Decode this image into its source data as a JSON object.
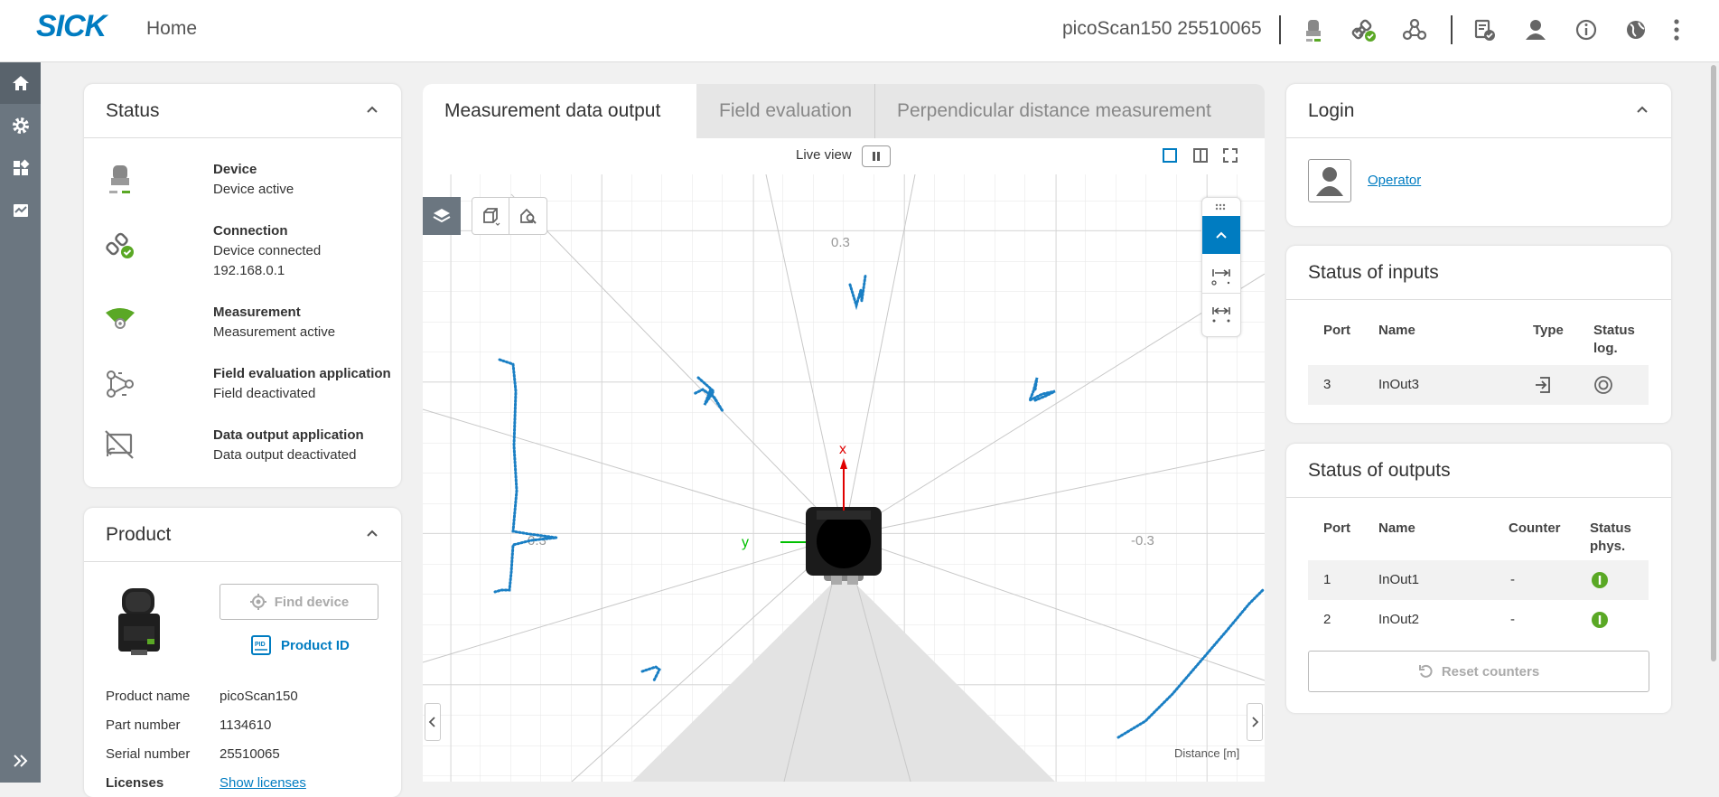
{
  "header": {
    "logo": "SICK",
    "home": "Home",
    "device": "picoScan150 25510065"
  },
  "status": {
    "title": "Status",
    "items": [
      {
        "title": "Device",
        "lines": [
          "Device active"
        ],
        "icon": "device-icon"
      },
      {
        "title": "Connection",
        "lines": [
          "Device connected",
          "192.168.0.1"
        ],
        "icon": "connection-icon"
      },
      {
        "title": "Measurement",
        "lines": [
          "Measurement active"
        ],
        "icon": "measurement-icon"
      },
      {
        "title": "Field evaluation application",
        "lines": [
          "Field deactivated"
        ],
        "icon": "field-evaluation-icon"
      },
      {
        "title": "Data output application",
        "lines": [
          "Data output deactivated"
        ],
        "icon": "data-output-icon"
      }
    ]
  },
  "product": {
    "title": "Product",
    "find_device": "Find device",
    "product_id": "Product ID",
    "rows": [
      {
        "label": "Product name",
        "value": "picoScan150"
      },
      {
        "label": "Part number",
        "value": "1134610"
      },
      {
        "label": "Serial number",
        "value": "25510065"
      },
      {
        "label": "Licenses",
        "value": "Show licenses"
      }
    ]
  },
  "viewer": {
    "tabs": [
      "Measurement data output",
      "Field evaluation",
      "Perpendicular distance measurement"
    ],
    "live_view": "Live view",
    "label_top": "0.3",
    "label_left": "0.3",
    "label_right": "-0.3",
    "axis_x": "x",
    "axis_y": "y",
    "distance_label": "Distance [m]"
  },
  "login": {
    "title": "Login",
    "user": "Operator"
  },
  "inputs": {
    "title": "Status of inputs",
    "headers": [
      "Port",
      "Name",
      "Type",
      "Status",
      "log."
    ],
    "rows": [
      {
        "port": "3",
        "name": "InOut3"
      }
    ]
  },
  "outputs": {
    "title": "Status of outputs",
    "headers": [
      "Port",
      "Name",
      "Counter",
      "Status",
      "phys."
    ],
    "rows": [
      {
        "port": "1",
        "name": "InOut1",
        "counter": "-"
      },
      {
        "port": "2",
        "name": "InOut2",
        "counter": "-"
      }
    ],
    "reset": "Reset counters"
  },
  "colors": {
    "brand": "#007cc1",
    "status_green": "#5aa825",
    "sidebar": "#6b7680",
    "scan_points": "#1a7fc4"
  }
}
